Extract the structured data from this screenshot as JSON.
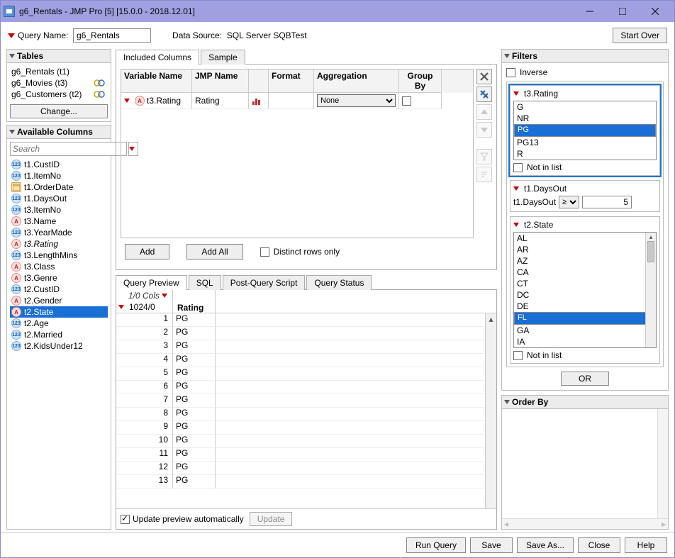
{
  "window": {
    "title": "g6_Rentals - JMP Pro [5] [15.0.0 - 2018.12.01]"
  },
  "topbar": {
    "queryNameLabel": "Query Name:",
    "queryName": "g6_Rentals",
    "dataSourceLabel": "Data Source:",
    "dataSource": "SQL Server SQBTest",
    "startOver": "Start Over"
  },
  "tables": {
    "title": "Tables",
    "items": [
      {
        "label": "g6_Rentals (t1)",
        "linked": false
      },
      {
        "label": "g6_Movies (t3)",
        "linked": true
      },
      {
        "label": "g6_Customers (t2)",
        "linked": true
      }
    ],
    "changeBtn": "Change..."
  },
  "availCols": {
    "title": "Available Columns",
    "searchPlaceholder": "Search",
    "items": [
      {
        "type": "num",
        "label": "t1.CustID"
      },
      {
        "type": "num",
        "label": "t1.ItemNo"
      },
      {
        "type": "date",
        "label": "t1.OrderDate"
      },
      {
        "type": "num",
        "label": "t1.DaysOut"
      },
      {
        "type": "num",
        "label": "t3.ItemNo"
      },
      {
        "type": "char",
        "label": "t3.Name"
      },
      {
        "type": "num",
        "label": "t3.YearMade"
      },
      {
        "type": "char",
        "label": "t3.Rating",
        "italic": true
      },
      {
        "type": "num",
        "label": "t3.LengthMins"
      },
      {
        "type": "char",
        "label": "t3.Class"
      },
      {
        "type": "char",
        "label": "t3.Genre"
      },
      {
        "type": "num",
        "label": "t2.CustID"
      },
      {
        "type": "char",
        "label": "t2.Gender"
      },
      {
        "type": "char",
        "label": "t2.State",
        "selected": true
      },
      {
        "type": "num",
        "label": "t2.Age"
      },
      {
        "type": "num",
        "label": "t2.Married"
      },
      {
        "type": "num",
        "label": "t2.KidsUnder12"
      }
    ]
  },
  "included": {
    "tabIncluded": "Included Columns",
    "tabSample": "Sample",
    "headVar": "Variable Name",
    "headJmp": "JMP Name",
    "headFmt": "Format",
    "headAgg": "Aggregation",
    "headGrp": "Group By",
    "row": {
      "var": "t3.Rating",
      "jmp": "Rating",
      "agg": "None"
    },
    "addBtn": "Add",
    "addAllBtn": "Add All",
    "distinct": "Distinct rows only"
  },
  "preview": {
    "tabPreview": "Query Preview",
    "tabSQL": "SQL",
    "tabPost": "Post-Query Script",
    "tabStatus": "Query Status",
    "cornerCols": "1/0 Cols",
    "cornerRows": "1024/0",
    "colHead": "Rating",
    "rows": [
      {
        "n": "1",
        "v": "PG"
      },
      {
        "n": "2",
        "v": "PG"
      },
      {
        "n": "3",
        "v": "PG"
      },
      {
        "n": "4",
        "v": "PG"
      },
      {
        "n": "5",
        "v": "PG"
      },
      {
        "n": "6",
        "v": "PG"
      },
      {
        "n": "7",
        "v": "PG"
      },
      {
        "n": "8",
        "v": "PG"
      },
      {
        "n": "9",
        "v": "PG"
      },
      {
        "n": "10",
        "v": "PG"
      },
      {
        "n": "11",
        "v": "PG"
      },
      {
        "n": "12",
        "v": "PG"
      },
      {
        "n": "13",
        "v": "PG"
      }
    ],
    "updateAuto": "Update preview automatically",
    "updateBtn": "Update"
  },
  "filters": {
    "title": "Filters",
    "inverse": "Inverse",
    "f1": {
      "name": "t3.Rating",
      "opts": [
        {
          "v": "G"
        },
        {
          "v": "NR"
        },
        {
          "v": "PG",
          "sel": true
        },
        {
          "v": "PG13"
        },
        {
          "v": "R"
        }
      ],
      "notInList": "Not in list"
    },
    "f2": {
      "name": "t1.DaysOut",
      "field": "t1.DaysOut",
      "op": "≥",
      "val": "5"
    },
    "f3": {
      "name": "t2.State",
      "opts": [
        {
          "v": "AL"
        },
        {
          "v": "AR"
        },
        {
          "v": "AZ"
        },
        {
          "v": "CA"
        },
        {
          "v": "CT"
        },
        {
          "v": "DC"
        },
        {
          "v": "DE"
        },
        {
          "v": "FL",
          "sel": true
        },
        {
          "v": "GA"
        },
        {
          "v": "IA"
        }
      ],
      "notInList": "Not in list"
    },
    "orBtn": "OR"
  },
  "orderBy": {
    "title": "Order By"
  },
  "footer": {
    "runQuery": "Run Query",
    "save": "Save",
    "saveAs": "Save As...",
    "close": "Close",
    "help": "Help"
  }
}
